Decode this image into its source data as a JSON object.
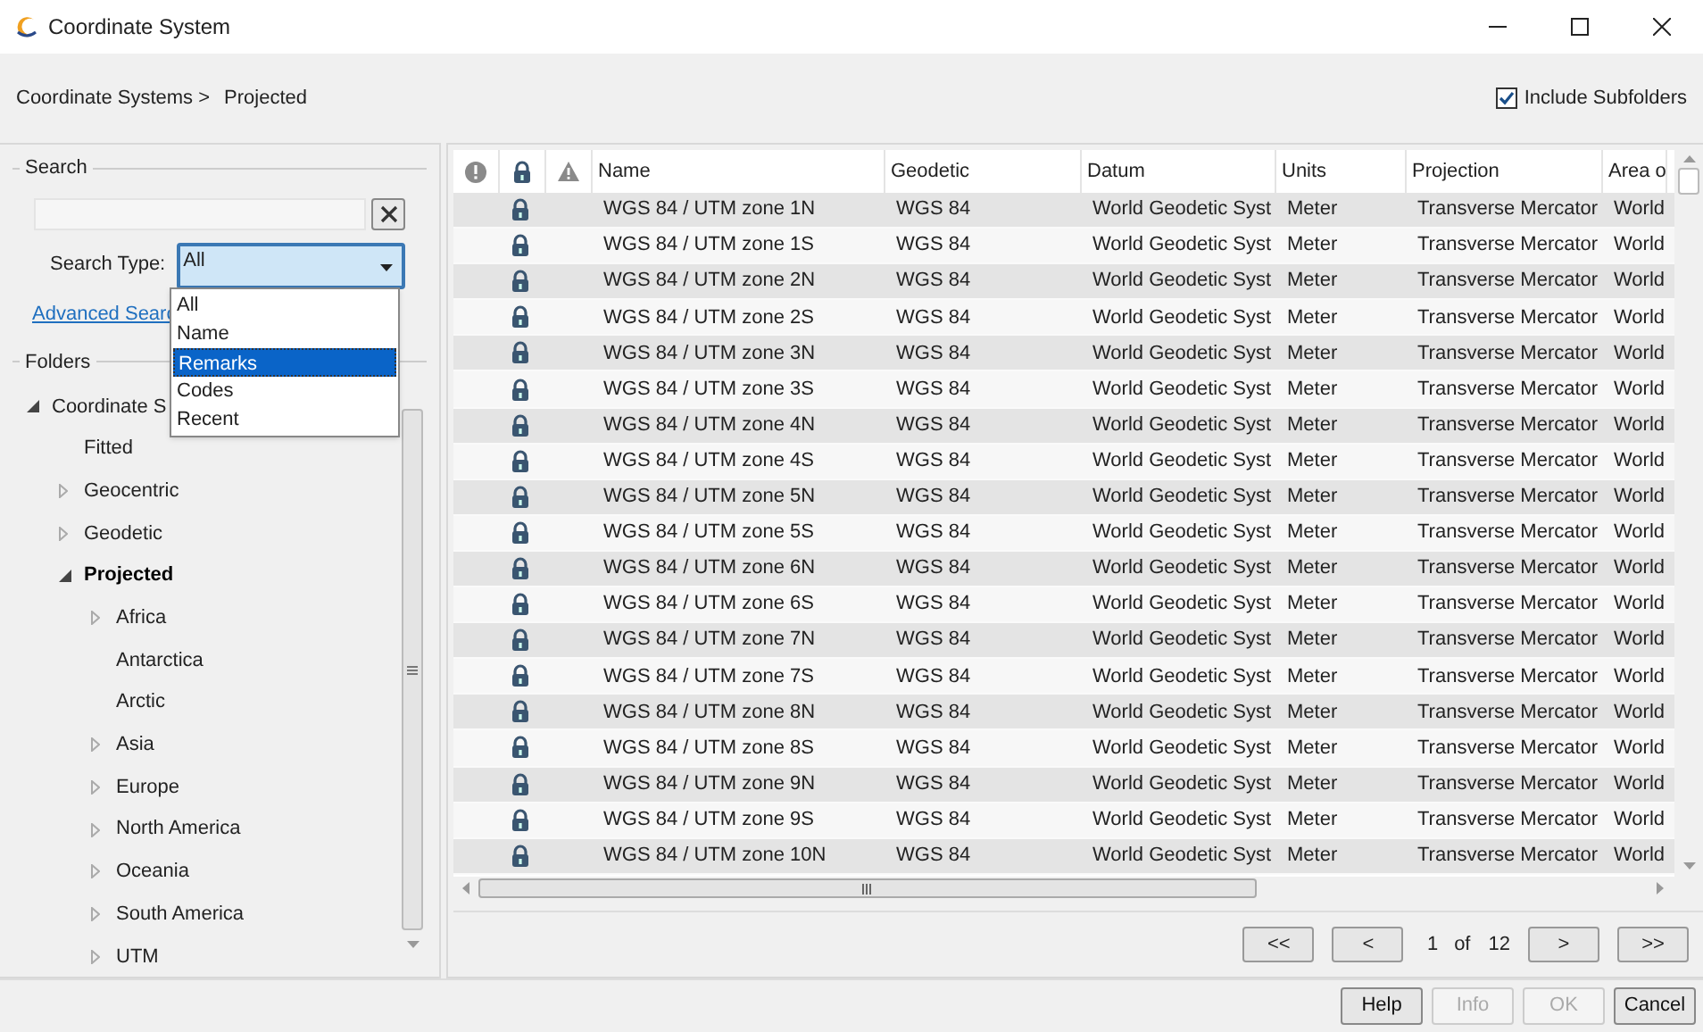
{
  "window": {
    "title": "Coordinate System"
  },
  "breadcrumb": [
    "Coordinate Systems >",
    "Projected"
  ],
  "include_subfolders": {
    "label": "Include Subfolders",
    "checked": true
  },
  "search": {
    "label": "Search",
    "search_type_label": "Search Type:",
    "search_type_value": "All",
    "advanced_link": "Advanced Searc",
    "dropdown_options": [
      {
        "label": "All",
        "selected": false
      },
      {
        "label": "Name",
        "selected": false
      },
      {
        "label": "Remarks",
        "selected": true
      },
      {
        "label": "Codes",
        "selected": false
      },
      {
        "label": "Recent",
        "selected": false
      }
    ]
  },
  "folders": {
    "label": "Folders",
    "tree": [
      {
        "label": "Coordinate S",
        "kind": "branch",
        "expanded": true,
        "selected": false,
        "children": [
          {
            "label": "Fitted",
            "kind": "leaf",
            "expanded": false,
            "selected": false
          },
          {
            "label": "Geocentric",
            "kind": "branch",
            "expanded": false,
            "selected": false
          },
          {
            "label": "Geodetic",
            "kind": "branch",
            "expanded": false,
            "selected": false
          },
          {
            "label": "Projected",
            "kind": "branch",
            "expanded": true,
            "selected": true,
            "children": [
              {
                "label": "Africa",
                "kind": "branch",
                "expanded": false,
                "selected": false
              },
              {
                "label": "Antarctica",
                "kind": "leaf",
                "expanded": false,
                "selected": false
              },
              {
                "label": "Arctic",
                "kind": "leaf",
                "expanded": false,
                "selected": false
              },
              {
                "label": "Asia",
                "kind": "branch",
                "expanded": false,
                "selected": false
              },
              {
                "label": "Europe",
                "kind": "branch",
                "expanded": false,
                "selected": false
              },
              {
                "label": "North America",
                "kind": "branch",
                "expanded": false,
                "selected": false
              },
              {
                "label": "Oceania",
                "kind": "branch",
                "expanded": false,
                "selected": false
              },
              {
                "label": "South America",
                "kind": "branch",
                "expanded": false,
                "selected": false
              },
              {
                "label": "UTM",
                "kind": "branch",
                "expanded": false,
                "selected": false
              }
            ]
          }
        ]
      }
    ]
  },
  "table": {
    "columns": [
      "Name",
      "Geodetic",
      "Datum",
      "Units",
      "Projection",
      "Area o"
    ],
    "rows": [
      [
        "WGS 84 / UTM zone 1N",
        "WGS 84",
        "World Geodetic Syst",
        "Meter",
        "Transverse Mercator",
        "World"
      ],
      [
        "WGS 84 / UTM zone 1S",
        "WGS 84",
        "World Geodetic Syst",
        "Meter",
        "Transverse Mercator",
        "World"
      ],
      [
        "WGS 84 / UTM zone 2N",
        "WGS 84",
        "World Geodetic Syst",
        "Meter",
        "Transverse Mercator",
        "World"
      ],
      [
        "WGS 84 / UTM zone 2S",
        "WGS 84",
        "World Geodetic Syst",
        "Meter",
        "Transverse Mercator",
        "World"
      ],
      [
        "WGS 84 / UTM zone 3N",
        "WGS 84",
        "World Geodetic Syst",
        "Meter",
        "Transverse Mercator",
        "World"
      ],
      [
        "WGS 84 / UTM zone 3S",
        "WGS 84",
        "World Geodetic Syst",
        "Meter",
        "Transverse Mercator",
        "World"
      ],
      [
        "WGS 84 / UTM zone 4N",
        "WGS 84",
        "World Geodetic Syst",
        "Meter",
        "Transverse Mercator",
        "World"
      ],
      [
        "WGS 84 / UTM zone 4S",
        "WGS 84",
        "World Geodetic Syst",
        "Meter",
        "Transverse Mercator",
        "World"
      ],
      [
        "WGS 84 / UTM zone 5N",
        "WGS 84",
        "World Geodetic Syst",
        "Meter",
        "Transverse Mercator",
        "World"
      ],
      [
        "WGS 84 / UTM zone 5S",
        "WGS 84",
        "World Geodetic Syst",
        "Meter",
        "Transverse Mercator",
        "World"
      ],
      [
        "WGS 84 / UTM zone 6N",
        "WGS 84",
        "World Geodetic Syst",
        "Meter",
        "Transverse Mercator",
        "World"
      ],
      [
        "WGS 84 / UTM zone 6S",
        "WGS 84",
        "World Geodetic Syst",
        "Meter",
        "Transverse Mercator",
        "World"
      ],
      [
        "WGS 84 / UTM zone 7N",
        "WGS 84",
        "World Geodetic Syst",
        "Meter",
        "Transverse Mercator",
        "World"
      ],
      [
        "WGS 84 / UTM zone 7S",
        "WGS 84",
        "World Geodetic Syst",
        "Meter",
        "Transverse Mercator",
        "World"
      ],
      [
        "WGS 84 / UTM zone 8N",
        "WGS 84",
        "World Geodetic Syst",
        "Meter",
        "Transverse Mercator",
        "World"
      ],
      [
        "WGS 84 / UTM zone 8S",
        "WGS 84",
        "World Geodetic Syst",
        "Meter",
        "Transverse Mercator",
        "World"
      ],
      [
        "WGS 84 / UTM zone 9N",
        "WGS 84",
        "World Geodetic Syst",
        "Meter",
        "Transverse Mercator",
        "World"
      ],
      [
        "WGS 84 / UTM zone 9S",
        "WGS 84",
        "World Geodetic Syst",
        "Meter",
        "Transverse Mercator",
        "World"
      ],
      [
        "WGS 84 / UTM zone 10N",
        "WGS 84",
        "World Geodetic Syst",
        "Meter",
        "Transverse Mercator",
        "World"
      ]
    ]
  },
  "pagination": {
    "first": "<<",
    "prev": "<",
    "page": "1",
    "of": "of",
    "total": "12",
    "next": ">",
    "last": ">>"
  },
  "buttons": [
    {
      "label": "Help",
      "disabled": false
    },
    {
      "label": "Info",
      "disabled": true
    },
    {
      "label": "OK",
      "disabled": true
    },
    {
      "label": "Cancel",
      "disabled": false
    }
  ]
}
